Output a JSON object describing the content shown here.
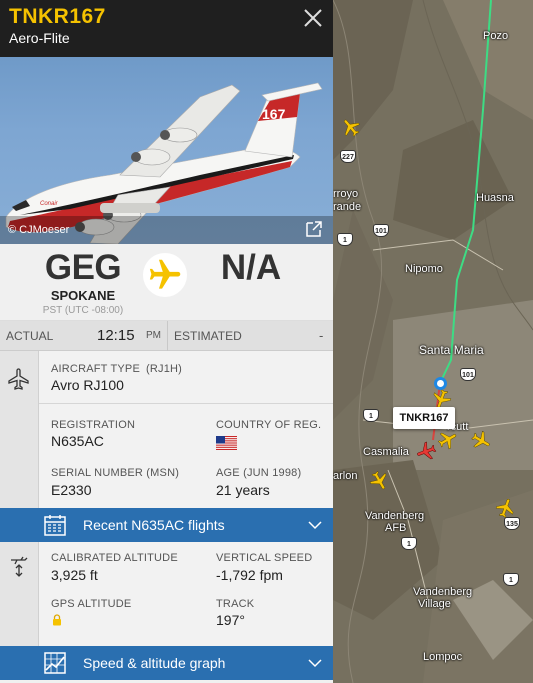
{
  "header": {
    "callsign": "TNKR167",
    "airline": "Aero-Flite",
    "close_icon": "close-icon"
  },
  "photo": {
    "credit": "© CJMoeser",
    "external_icon": "external-link-icon",
    "tail_number": "167",
    "brand": "Conair"
  },
  "route": {
    "origin_code": "GEG",
    "origin_city": "SPOKANE",
    "origin_tz": "PST (UTC -08:00)",
    "destination_code": "N/A",
    "plane_icon": "airplane-icon"
  },
  "times": {
    "actual_label": "ACTUAL",
    "actual_time": "12:15",
    "actual_ampm": "PM",
    "estimated_label": "ESTIMATED",
    "estimated_value": "-"
  },
  "aircraft": {
    "type_label": "AIRCRAFT TYPE",
    "type_code": "(RJ1H)",
    "type_value": "Avro RJ100",
    "registration_label": "REGISTRATION",
    "registration_value": "N635AC",
    "country_label": "COUNTRY OF REG.",
    "country_flag": "us-flag-icon",
    "serial_label": "SERIAL NUMBER (MSN)",
    "serial_value": "E2330",
    "age_label": "AGE (JUN 1998)",
    "age_value": "21 years"
  },
  "recent_flights": {
    "label": "Recent N635AC flights"
  },
  "altitude": {
    "calibrated_label": "CALIBRATED ALTITUDE",
    "calibrated_value": "3,925 ft",
    "vspeed_label": "VERTICAL SPEED",
    "vspeed_value": "-1,792 fpm",
    "gps_label": "GPS ALTITUDE",
    "gps_icon": "lock-icon",
    "track_label": "TRACK",
    "track_value": "197°"
  },
  "graph_bar": {
    "label": "Speed & altitude graph"
  },
  "map": {
    "callsign_tag": "TNKR167",
    "places": {
      "pozo": "Pozo",
      "arroyo": "rroyo",
      "grande": "rande",
      "huasna": "Huasna",
      "nipomo": "Nipomo",
      "santa_maria": "Santa Maria",
      "orcutt": "rcutt",
      "casmalia": "Casmalia",
      "arlon": "arlon",
      "vandenberg": "Vandenberg",
      "afb": "AFB",
      "vandenberg_village_1": "Vandenberg",
      "vandenberg_village_2": "Village",
      "lompoc": "Lompoc"
    },
    "shields": {
      "r227": "227",
      "r101a": "101",
      "r1a": "1",
      "r1b": "1",
      "r101b": "101",
      "r135": "135",
      "r1c": "1",
      "r1d": "1"
    },
    "track_color": "#3ddc84",
    "aircraft_color": "#f5c200",
    "selected_color": "#e53935"
  },
  "colors": {
    "accent_yellow": "#f5c200",
    "header_bg": "#1f1f1f",
    "bar_blue": "#2a6fb0"
  }
}
